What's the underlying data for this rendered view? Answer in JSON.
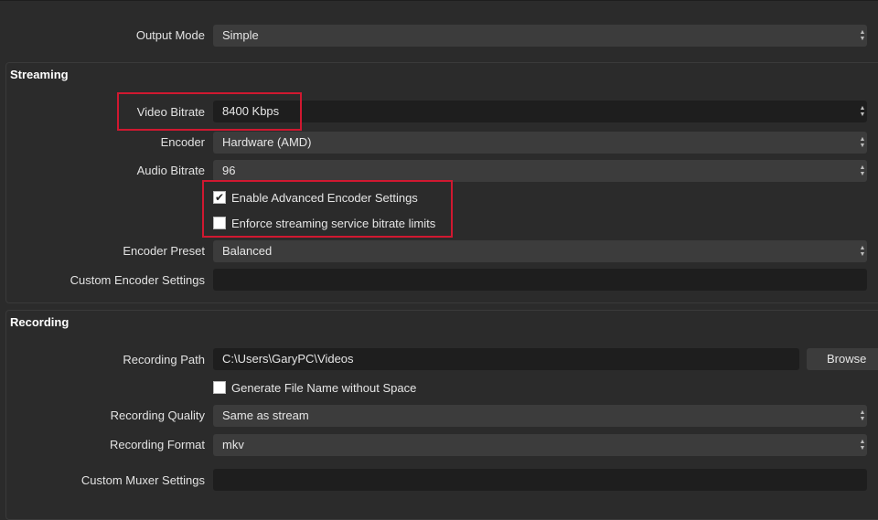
{
  "output_mode": {
    "label": "Output Mode",
    "value": "Simple"
  },
  "streaming": {
    "title": "Streaming",
    "video_bitrate": {
      "label": "Video Bitrate",
      "value": "8400 Kbps"
    },
    "encoder": {
      "label": "Encoder",
      "value": "Hardware (AMD)"
    },
    "audio_bitrate": {
      "label": "Audio Bitrate",
      "value": "96"
    },
    "enable_advanced": {
      "label": "Enable Advanced Encoder Settings",
      "checked": true,
      "mark": "✔"
    },
    "enforce_limits": {
      "label": "Enforce streaming service bitrate limits",
      "checked": false
    },
    "encoder_preset": {
      "label": "Encoder Preset",
      "value": "Balanced"
    },
    "custom_encoder": {
      "label": "Custom Encoder Settings",
      "value": ""
    }
  },
  "recording": {
    "title": "Recording",
    "path": {
      "label": "Recording Path",
      "value": "C:\\Users\\GaryPC\\Videos"
    },
    "browse_label": "Browse",
    "no_space": {
      "label": "Generate File Name without Space",
      "checked": false
    },
    "quality": {
      "label": "Recording Quality",
      "value": "Same as stream"
    },
    "format": {
      "label": "Recording Format",
      "value": "mkv"
    },
    "custom_muxer": {
      "label": "Custom Muxer Settings",
      "value": ""
    }
  },
  "colors": {
    "background": "#2b2b2b",
    "field": "#3c3c3c",
    "field_dark": "#1e1e1e",
    "highlight": "#d01830"
  }
}
